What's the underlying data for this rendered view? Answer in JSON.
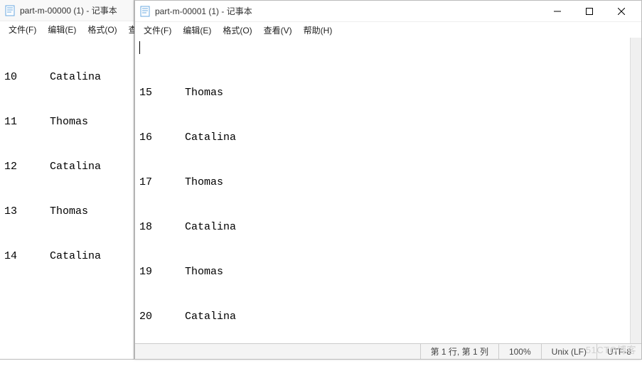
{
  "back_window": {
    "title": "part-m-00000 (1) - 记事本",
    "menu": {
      "file": "文件(F)",
      "edit": "编辑(E)",
      "format": "格式(O)",
      "view_trunc": "查看"
    },
    "rows": [
      {
        "id": "10",
        "name": "Catalina"
      },
      {
        "id": "11",
        "name": "Thomas"
      },
      {
        "id": "12",
        "name": "Catalina"
      },
      {
        "id": "13",
        "name": "Thomas"
      },
      {
        "id": "14",
        "name": "Catalina"
      }
    ]
  },
  "front_window": {
    "title": "part-m-00001 (1) - 记事本",
    "menu": {
      "file": "文件(F)",
      "edit": "编辑(E)",
      "format": "格式(O)",
      "view": "查看(V)",
      "help": "帮助(H)"
    },
    "rows": [
      {
        "id": "15",
        "name": "Thomas"
      },
      {
        "id": "16",
        "name": "Catalina"
      },
      {
        "id": "17",
        "name": "Thomas"
      },
      {
        "id": "18",
        "name": "Catalina"
      },
      {
        "id": "19",
        "name": "Thomas"
      },
      {
        "id": "20",
        "name": "Catalina"
      }
    ],
    "status": {
      "position": "第 1 行, 第 1 列",
      "zoom": "100%",
      "line_ending": "Unix (LF)",
      "encoding": "UTF-8"
    }
  },
  "watermark": "51CTO博客"
}
